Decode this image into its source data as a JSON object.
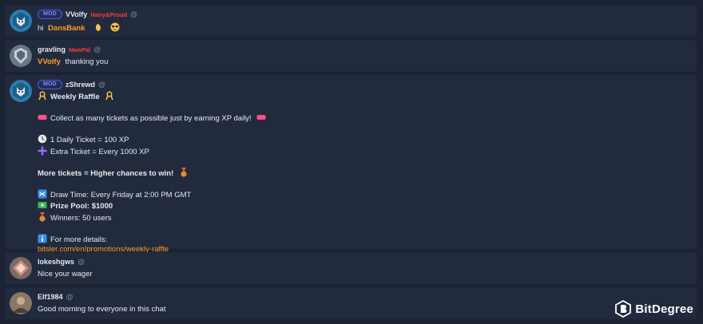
{
  "messages": [
    {
      "username": "VVolfy",
      "badge": "MOD",
      "tag": "Hairy&Proud",
      "at": "@",
      "avatar_icon": "wolf-avatar-icon",
      "line_prefix": "hi",
      "mention": "DansBank",
      "emojis": [
        "waving-hand-icon",
        "sunglasses-face-icon"
      ]
    },
    {
      "username": "gravling",
      "tag": "NwoPal",
      "at": "@",
      "avatar_icon": "shield-avatar-icon",
      "mention": "VVolfy",
      "text": "thanking you"
    },
    {
      "username": "zShrewd",
      "badge": "MOD",
      "at": "@",
      "avatar_icon": "wolf-avatar-icon",
      "lines": {
        "title": "Weekly Raffle",
        "collect": "Collect as many tickets as possible just by earning XP daily!",
        "daily": "1 Daily Ticket = 100 XP",
        "extra": "Extra Ticket = Every 1000 XP",
        "more": "More tickets = Higher chances to win!",
        "draw": "Draw Time: Every Friday at 2:00 PM GMT",
        "prize": "Prize Pool: $1000",
        "winners": "Winners: 50 users",
        "details": "For more details:",
        "link": "bitsler.com/en/promotions/weekly-raffle"
      }
    },
    {
      "username": "lokeshgws",
      "at": "@",
      "avatar_icon": "diamond-avatar-icon",
      "text": "Nice your wager"
    },
    {
      "username": "Elf1984",
      "at": "@",
      "avatar_icon": "photo-avatar-icon",
      "text": "Good morning to everyone in this chat"
    }
  ],
  "branding": {
    "logo_text": "BitDegree"
  },
  "colors": {
    "background": "#1b2233",
    "card": "#222b3d",
    "mention": "#ff9b2a",
    "tag_red": "#ff3b3b",
    "mod_badge": "#4b58ff"
  }
}
